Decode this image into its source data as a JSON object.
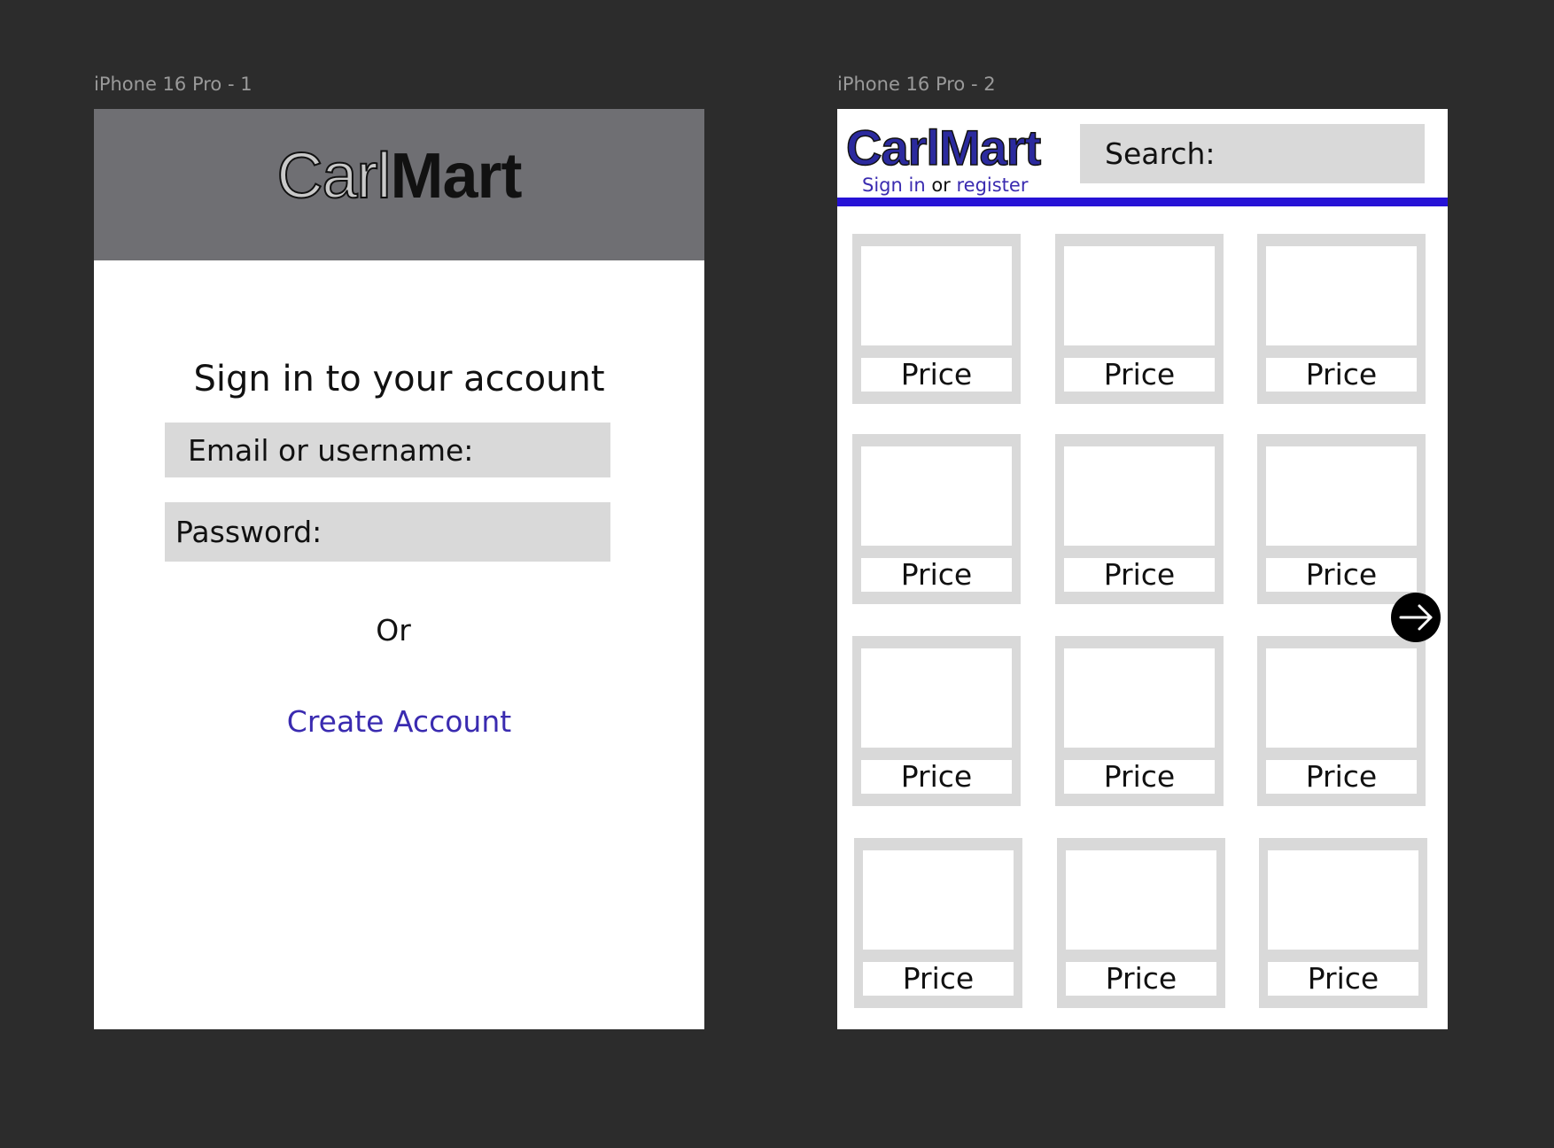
{
  "frames": [
    {
      "label": "iPhone 16 Pro - 1"
    },
    {
      "label": "iPhone 16 Pro - 2"
    }
  ],
  "signin": {
    "logo_light": "Carl",
    "logo_dark": "Mart",
    "heading": "Sign in to your account",
    "email_placeholder": "Email or username:",
    "password_placeholder": "Password:",
    "or_text": "Or",
    "create_account": "Create Account"
  },
  "store": {
    "logo": "CarlMart",
    "sign_in": "Sign in",
    "or_text": "or",
    "register": "register",
    "search_placeholder": "Search:",
    "next_icon": "arrow-right-circle-icon",
    "products": [
      {
        "price": "Price"
      },
      {
        "price": "Price"
      },
      {
        "price": "Price"
      },
      {
        "price": "Price"
      },
      {
        "price": "Price"
      },
      {
        "price": "Price"
      },
      {
        "price": "Price"
      },
      {
        "price": "Price"
      },
      {
        "price": "Price"
      },
      {
        "price": "Price"
      },
      {
        "price": "Price"
      },
      {
        "price": "Price"
      }
    ]
  },
  "colors": {
    "canvas": "#2c2c2c",
    "header_gray": "#6f6f73",
    "field_gray": "#d9d9d9",
    "link_purple": "#3a2bb0",
    "brand_blue": "#2b2a9e",
    "divider_blue": "#2612d6"
  }
}
